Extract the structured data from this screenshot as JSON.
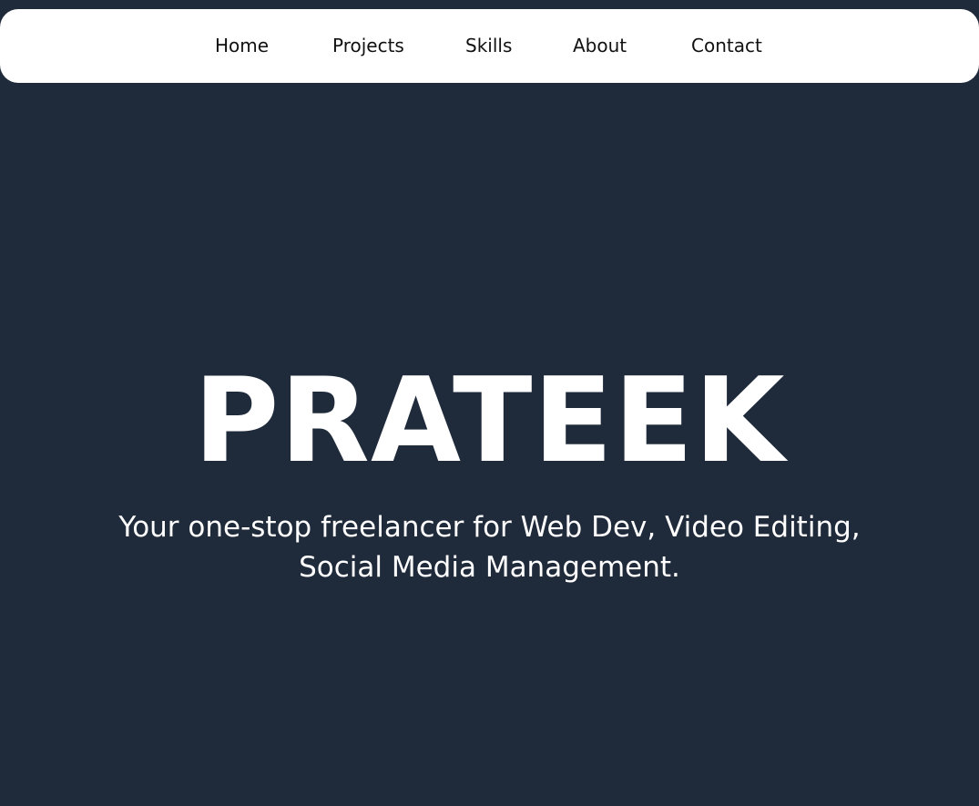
{
  "nav": {
    "items": [
      {
        "label": "Home"
      },
      {
        "label": "Projects"
      },
      {
        "label": "Skills"
      },
      {
        "label": "About"
      },
      {
        "label": "Contact"
      }
    ]
  },
  "hero": {
    "title": "PRATEEK",
    "tagline": "Your one-stop freelancer for Web Dev, Video Editing, Social Media Management."
  },
  "colors": {
    "background": "#1f2a3b",
    "navbar": "#ffffff",
    "text_light": "#ffffff",
    "text_dark": "#111111"
  }
}
